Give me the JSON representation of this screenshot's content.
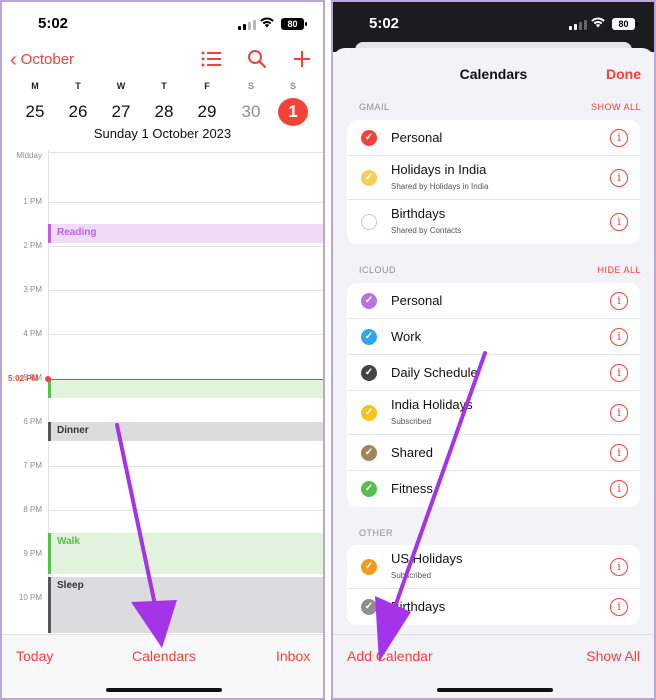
{
  "left": {
    "status": {
      "time": "5:02",
      "battery": "80"
    },
    "nav": {
      "back_label": "October"
    },
    "week": {
      "days": [
        "M",
        "T",
        "W",
        "T",
        "F",
        "S",
        "S"
      ],
      "dates": [
        "25",
        "26",
        "27",
        "28",
        "29",
        "30",
        "1"
      ],
      "selected_index": 6
    },
    "selected_date": "Sunday  1 October 2023",
    "timeline": {
      "top_label": "Midday",
      "hours": [
        "1 PM",
        "2 PM",
        "3 PM",
        "4 PM",
        "5 PM",
        "6 PM",
        "7 PM",
        "8 PM",
        "9 PM",
        "10 PM"
      ],
      "now_label": "5:02 PM"
    },
    "events": [
      {
        "title": "Reading",
        "color": "#c161e0"
      },
      {
        "title": "",
        "color": "#58c04a"
      },
      {
        "title": "Dinner",
        "color": "#555555"
      },
      {
        "title": "Walk",
        "color": "#58c04a"
      },
      {
        "title": "Sleep",
        "color": "#555555"
      }
    ],
    "tabs": {
      "today": "Today",
      "calendars": "Calendars",
      "inbox": "Inbox"
    }
  },
  "right": {
    "status": {
      "time": "5:02",
      "battery": "80"
    },
    "title": "Calendars",
    "done": "Done",
    "sections": [
      {
        "header": "GMAIL",
        "action": "SHOW ALL",
        "items": [
          {
            "name": "Personal",
            "sub": "",
            "color": "#f2423a",
            "checked": true
          },
          {
            "name": "Holidays in India",
            "sub": "Shared by Holidays in India",
            "color": "#f6cf57",
            "checked": true
          },
          {
            "name": "Birthdays",
            "sub": "Shared by Contacts",
            "color": "#c7c7cc",
            "checked": false
          }
        ]
      },
      {
        "header": "ICLOUD",
        "action": "HIDE ALL",
        "items": [
          {
            "name": "Personal",
            "sub": "",
            "color": "#b773e2",
            "checked": true
          },
          {
            "name": "Work",
            "sub": "",
            "color": "#2ca6ef",
            "checked": true
          },
          {
            "name": "Daily Schedule",
            "sub": "",
            "color": "#444444",
            "checked": true
          },
          {
            "name": "India Holidays",
            "sub": "Subscribed",
            "color": "#f7c21a",
            "checked": true
          },
          {
            "name": "Shared",
            "sub": "",
            "color": "#a2835f",
            "checked": true
          },
          {
            "name": "Fitness",
            "sub": "",
            "color": "#58c04a",
            "checked": true
          }
        ]
      },
      {
        "header": "OTHER",
        "action": "",
        "items": [
          {
            "name": "US Holidays",
            "sub": "Subscribed",
            "color": "#f29a1a",
            "checked": true
          },
          {
            "name": "Birthdays",
            "sub": "",
            "color": "#8e8e93",
            "checked": true
          }
        ]
      }
    ],
    "bottom": {
      "add": "Add Calendar",
      "show_all": "Show All"
    }
  },
  "colors": {
    "accent": "#f2423a",
    "arrow": "#a533e8"
  }
}
